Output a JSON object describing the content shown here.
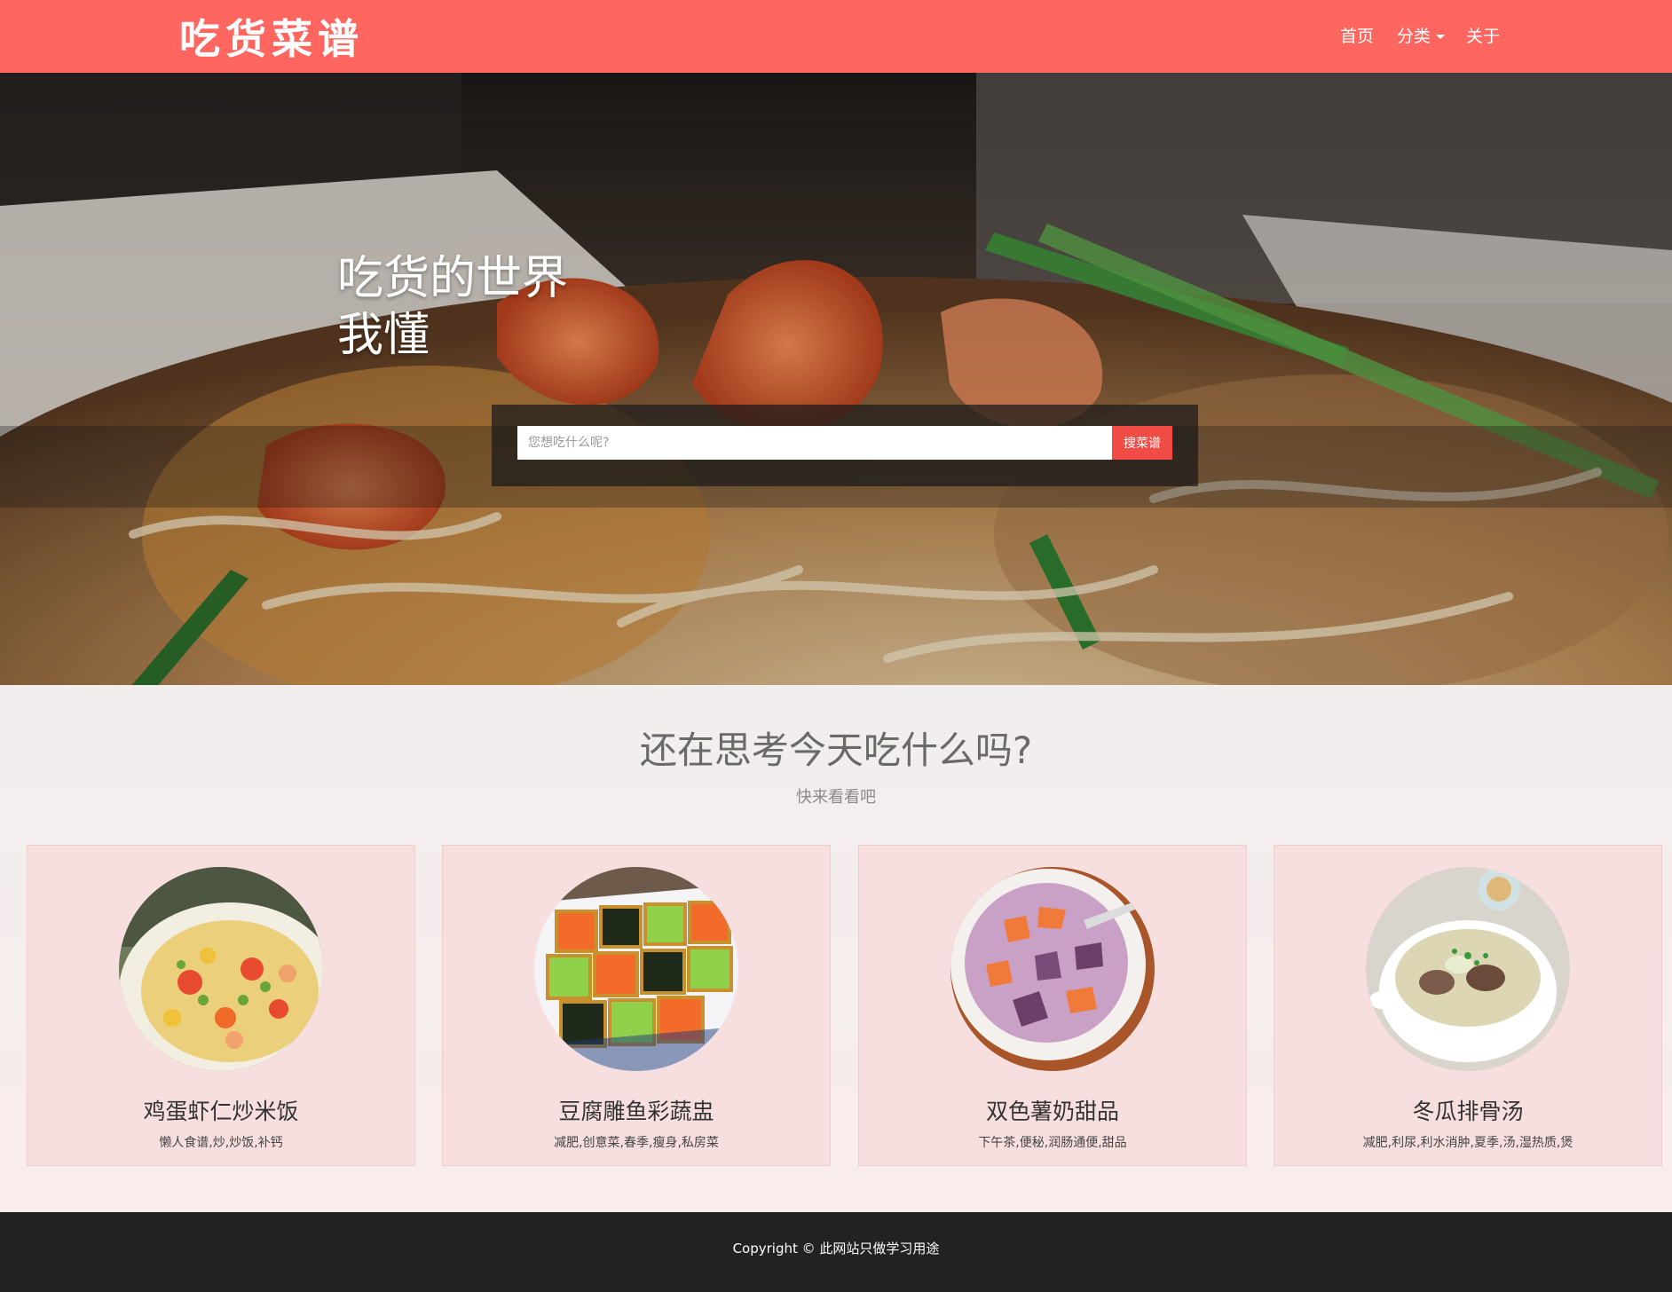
{
  "header": {
    "logo": "吃货菜谱",
    "nav": [
      {
        "label": "首页"
      },
      {
        "label": "分类"
      },
      {
        "label": "关于"
      }
    ]
  },
  "hero": {
    "title": "吃货的世界",
    "subtitle": "我懂",
    "search_placeholder": "您想吃什么呢?",
    "search_button": "搜菜谱"
  },
  "section": {
    "title": "还在思考今天吃什么吗?",
    "subtitle": "快来看看吧"
  },
  "recipes": [
    {
      "name": "鸡蛋虾仁炒米饭",
      "tags": "懒人食谱,炒,炒饭,补钙"
    },
    {
      "name": "豆腐雕鱼彩蔬盅",
      "tags": "减肥,创意菜,春季,瘦身,私房菜"
    },
    {
      "name": "双色薯奶甜品",
      "tags": "下午茶,便秘,润肠通便,甜品"
    },
    {
      "name": "冬瓜排骨汤",
      "tags": "减肥,利尿,利水消肿,夏季,汤,湿热质,煲"
    }
  ],
  "footer": {
    "text": "Copyright © 此网站只做学习用途"
  },
  "colors": {
    "brand": "#ff6660",
    "search_button": "#f04b45",
    "card_bg": "#f7dfdf",
    "footer_bg": "#222222"
  }
}
